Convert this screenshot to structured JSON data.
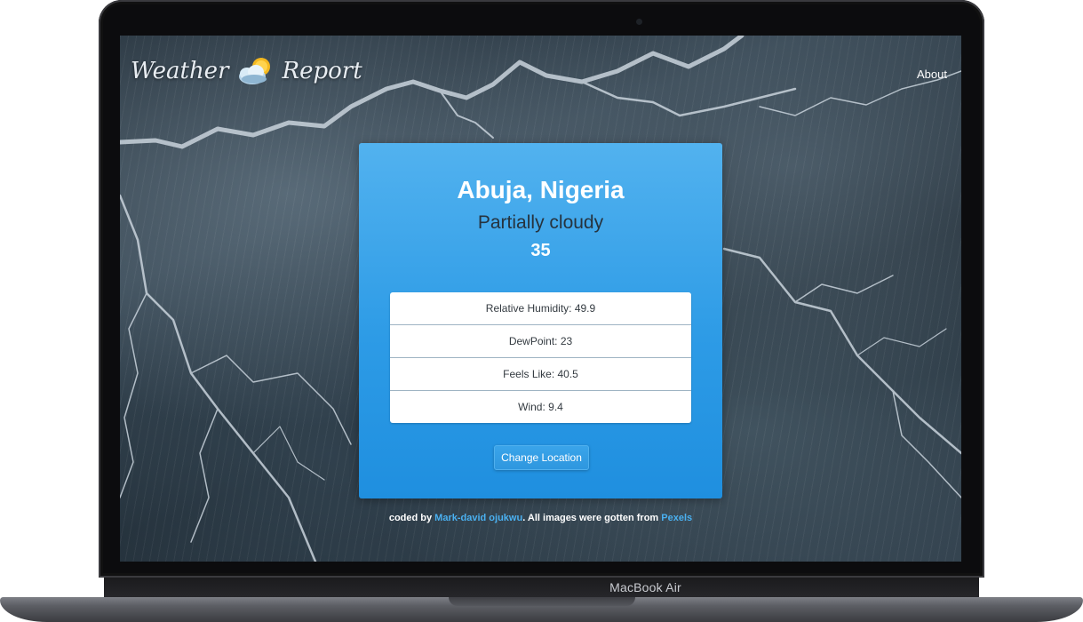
{
  "device": {
    "model_label": "MacBook Air"
  },
  "nav": {
    "brand_left": "Weather",
    "brand_right": "Report",
    "brand_icon": "sun-behind-cloud-icon",
    "about_label": "About"
  },
  "weather": {
    "location": "Abuja, Nigeria",
    "condition": "Partially cloudy",
    "temperature": "35",
    "details": [
      {
        "label": "Relative Humidity: 49.9"
      },
      {
        "label": "DewPoint: 23"
      },
      {
        "label": "Feels Like: 40.5"
      },
      {
        "label": "Wind: 9.4"
      }
    ],
    "change_location_label": "Change Location"
  },
  "footer": {
    "prefix": "coded by ",
    "author": "Mark-david ojukwu",
    "middle": ". All images were gotten from ",
    "source": "Pexels"
  },
  "colors": {
    "card_top": "#52b2ef",
    "card_bottom": "#1f8fdf",
    "link": "#4ab0f0",
    "condition_text": "#26333e"
  }
}
